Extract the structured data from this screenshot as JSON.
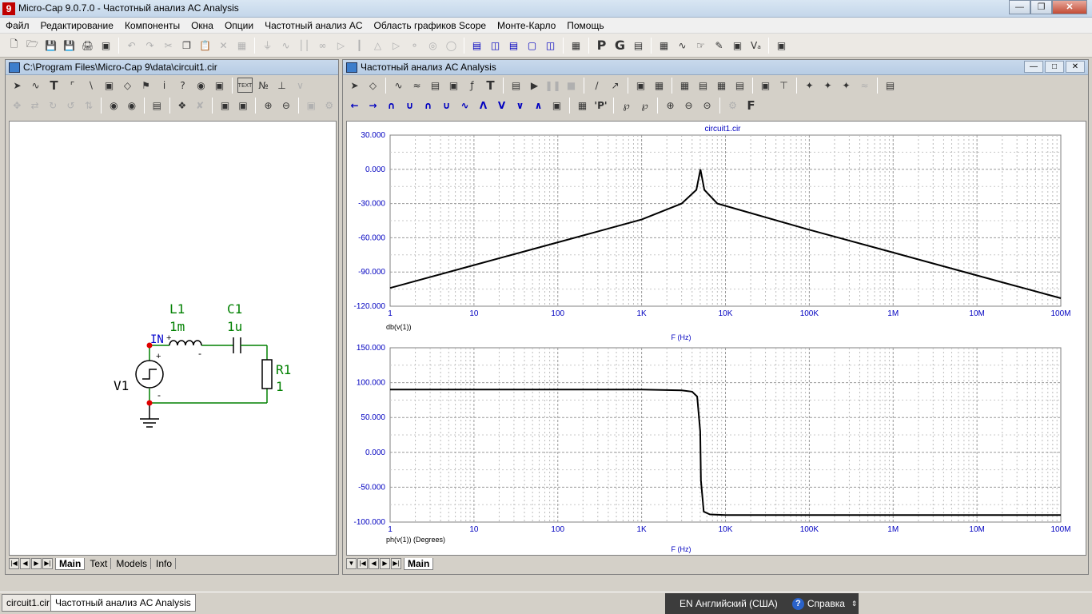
{
  "app": {
    "title": "Micro-Cap 9.0.7.0 - Частотный анализ AC Analysis",
    "icon_letter": "9"
  },
  "menu": [
    "Файл",
    "Редактирование",
    "Компоненты",
    "Окна",
    "Опции",
    "Частотный анализ AC",
    "Область графиков Scope",
    "Монте-Карло",
    "Помощь"
  ],
  "schematic": {
    "title": "C:\\Program Files\\Micro-Cap 9\\data\\circuit1.cir",
    "labels": {
      "l1_name": "L1",
      "l1_val": "1m",
      "c1_name": "C1",
      "c1_val": "1u",
      "r1_name": "R1",
      "r1_val": "1",
      "v1_name": "V1",
      "node_in": "IN",
      "plus1": "+",
      "minus1": "-",
      "plus2": "+",
      "minus2": "-"
    },
    "tabs": [
      "Main",
      "Text",
      "Models",
      "Info"
    ],
    "active_tab": "Main"
  },
  "analysis": {
    "title": "Частотный анализ AC Analysis",
    "plot_title": "circuit1.cir",
    "tabs": [
      "Main"
    ],
    "xlabel": "F (Hz)",
    "x_ticks": [
      "1",
      "10",
      "100",
      "1K",
      "10K",
      "100K",
      "1M",
      "10M",
      "100M"
    ],
    "top": {
      "ylabel": "db(v(1))",
      "y_ticks": [
        "30.000",
        "0.000",
        "-30.000",
        "-60.000",
        "-90.000",
        "-120.000"
      ]
    },
    "bottom": {
      "ylabel": "ph(v(1)) (Degrees)",
      "y_ticks": [
        "150.000",
        "100.000",
        "50.000",
        "0.000",
        "-50.000",
        "-100.000"
      ]
    }
  },
  "chart_data": [
    {
      "type": "line",
      "title": "circuit1.cir",
      "xlabel": "F (Hz)",
      "ylabel": "db(v(1))",
      "xscale": "log",
      "xlim": [
        1,
        100000000
      ],
      "ylim": [
        -120,
        30
      ],
      "grid": true,
      "series": [
        {
          "values_x": [
            1,
            10,
            100,
            1000,
            3000,
            4500,
            5033,
            5600,
            8000,
            10000,
            100000,
            1000000,
            10000000,
            100000000
          ],
          "values_y": [
            -104,
            -84,
            -64,
            -44,
            -30,
            -18,
            0,
            -18,
            -30,
            -32,
            -53,
            -73,
            -93,
            -113
          ]
        }
      ]
    },
    {
      "type": "line",
      "xlabel": "F (Hz)",
      "ylabel": "ph(v(1)) (Degrees)",
      "xscale": "log",
      "xlim": [
        1,
        100000000
      ],
      "ylim": [
        -100,
        150
      ],
      "grid": true,
      "series": [
        {
          "values_x": [
            1,
            1000,
            3000,
            4000,
            4600,
            5000,
            5100,
            5500,
            6500,
            10000,
            100000000
          ],
          "values_y": [
            90,
            90,
            89,
            87,
            80,
            30,
            -40,
            -85,
            -89,
            -90,
            -90
          ]
        }
      ]
    }
  ],
  "taskbar": {
    "items": [
      "circuit1.cir",
      "Частотный анализ AC Analysis"
    ],
    "lang": "EN Английский (США)",
    "help": "Справка"
  }
}
